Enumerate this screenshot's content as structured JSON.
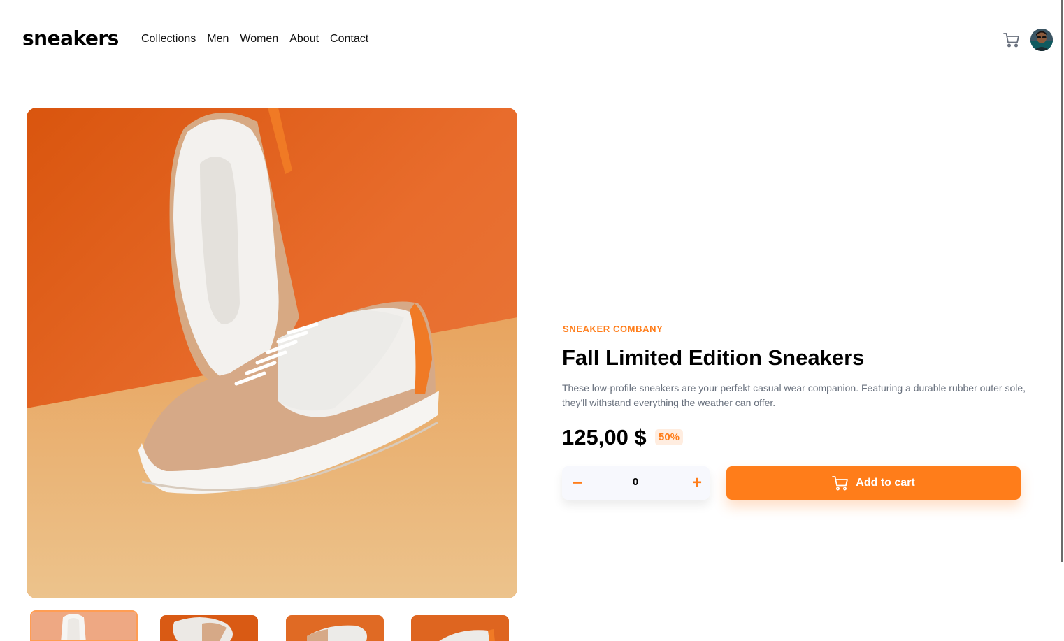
{
  "brand": {
    "logo": "sneakers",
    "accent": "#ff7d1a",
    "accent_pale": "#ffede0"
  },
  "nav": {
    "items": [
      "Collections",
      "Men",
      "Women",
      "About",
      "Contact"
    ]
  },
  "header": {
    "cart_icon": "cart-icon",
    "avatar": "user-avatar"
  },
  "gallery": {
    "main_image": "sneaker-photo",
    "thumbnails": [
      {
        "icon": "thumbnail-1",
        "active": true
      },
      {
        "icon": "thumbnail-2",
        "active": false
      },
      {
        "icon": "thumbnail-3",
        "active": false
      },
      {
        "icon": "thumbnail-4",
        "active": false
      }
    ]
  },
  "product": {
    "company": "SNEAKER COMBANY",
    "title": "Fall Limited Edition Sneakers",
    "description": "These low-profile sneakers are your perfekt casual wear companion. Featuring a durable rubber outer sole, they'll withstand everything the weather can offer.",
    "price": "125,00 $",
    "discount": "50%"
  },
  "cart_controls": {
    "minus_label": "−",
    "quantity": "0",
    "plus_label": "+",
    "add_label": "Add to cart"
  }
}
